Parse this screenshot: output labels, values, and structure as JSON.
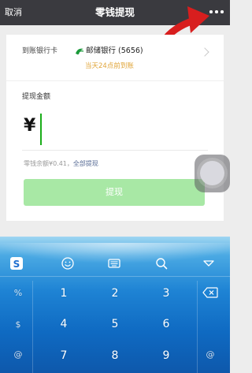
{
  "header": {
    "cancel_label": "取消",
    "title": "零钱提现",
    "more_icon": "more-horizontal-icon"
  },
  "card": {
    "bank_label": "到账银行卡",
    "bank_name": "邮储银行 (5656)",
    "bank_icon": "postal-bank-logo-icon",
    "arrival_note": "当天24点前到账",
    "amount_label": "提现金额",
    "currency_symbol": "¥",
    "amount_value": "",
    "balance_text": "零钱余额¥0.41，",
    "withdraw_all_label": "全部提现",
    "withdraw_button_label": "提现"
  },
  "keyboard": {
    "toolbar_icons": [
      "sogou-logo-icon",
      "emoji-icon",
      "keyboard-icon",
      "search-icon",
      "collapse-keyboard-icon"
    ],
    "side_left": [
      "%",
      "$",
      "@"
    ],
    "side_right_icons": [
      "backspace-icon"
    ],
    "side_right": [
      "",
      "",
      "@"
    ],
    "row1": [
      "1",
      "2",
      "3"
    ],
    "row2": [
      "4",
      "5",
      "6"
    ],
    "row3": [
      "7",
      "8",
      "9"
    ]
  },
  "colors": {
    "topbar": "#3a3a3f",
    "accent_green": "#1aad19",
    "button_disabled_green": "#a8e8a5",
    "arrival_orange": "#e0a53a",
    "link_blue": "#576b95",
    "annotation_red": "#d81e1e"
  }
}
